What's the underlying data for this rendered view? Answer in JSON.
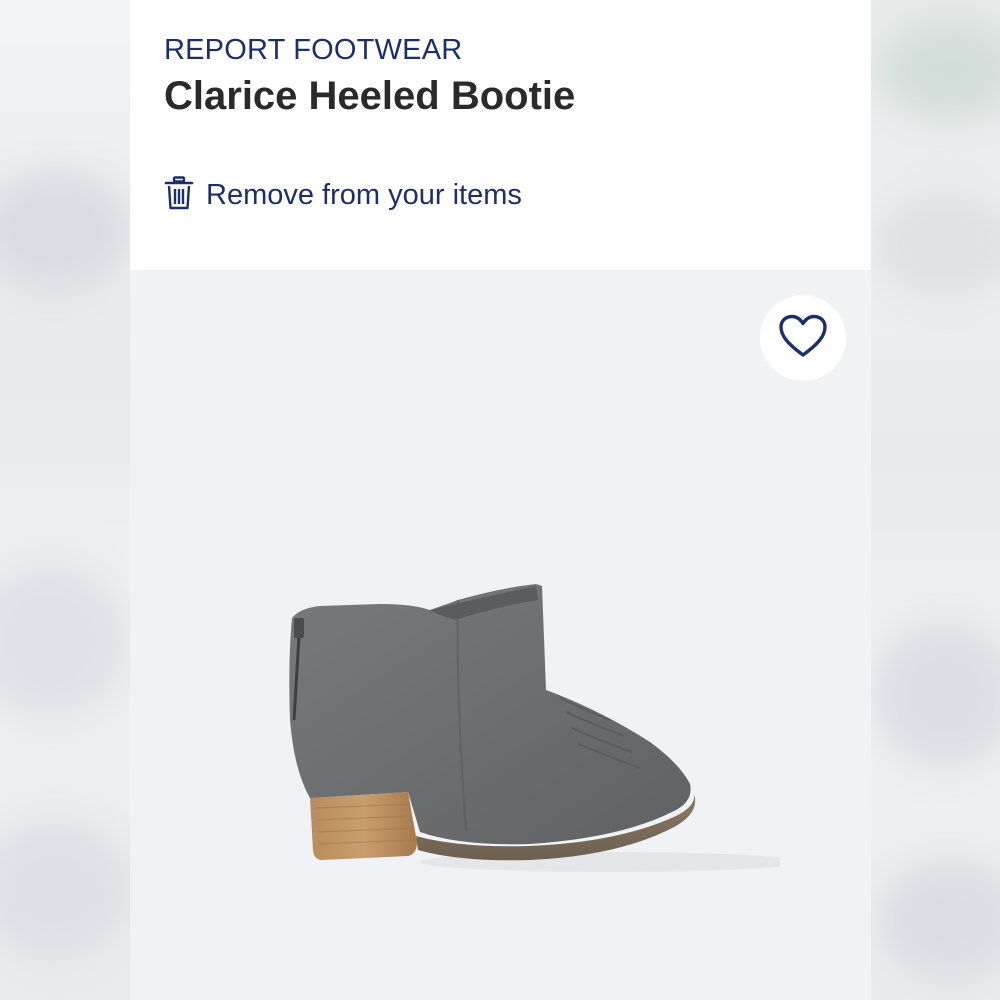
{
  "product": {
    "brand": "REPORT FOOTWEAR",
    "name": "Clarice Heeled Bootie"
  },
  "actions": {
    "remove_label": "Remove from your items"
  },
  "icons": {
    "remove": "trash-icon",
    "favorite": "heart-icon"
  },
  "colors": {
    "accent": "#1d2f6b",
    "title": "#2a2a2a",
    "image_bg": "#f0f2f5"
  }
}
